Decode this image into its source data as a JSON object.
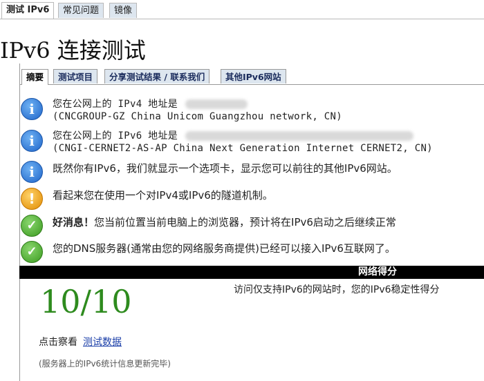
{
  "top_tabs": [
    "测试 IPv6",
    "常见问题",
    "镜像"
  ],
  "page_title": "IPv6 连接测试",
  "inner_tabs": [
    "摘要",
    "测试项目",
    "分享测试结果 / 联系我们",
    "其他IPv6网站"
  ],
  "messages": [
    {
      "type": "info",
      "line1": "您在公网上的 IPv4 地址是",
      "line2": "(CNCGROUP-GZ China Unicom Guangzhou network, CN)"
    },
    {
      "type": "info",
      "line1": "您在公网上的 IPv6 地址是",
      "line2": "(CNGI-CERNET2-AS-AP China Next Generation Internet CERNET2, CN)"
    },
    {
      "type": "info",
      "line1": "既然你有IPv6，我们就显示一个选项卡，显示您可以前往的其他IPv6网站。"
    },
    {
      "type": "warn",
      "line1": "看起来您在使用一个对IPv4或IPv6的隧道机制。"
    },
    {
      "type": "ok",
      "bold": "好消息！",
      "line1": "您当前位置当前电脑上的浏览器，预计将在IPv6启动之后继续正常"
    },
    {
      "type": "ok",
      "line1": "您的DNS服务器(通常由您的网络服务商提供)已经可以接入IPv6互联网了。"
    }
  ],
  "score": {
    "bar_label": "网络得分",
    "note": "访问仅支持IPv6的网站时，您的IPv6稳定性得分",
    "value": "10/10"
  },
  "detail": {
    "label": "点击察看",
    "link": "测试数据"
  },
  "footer_note": "(服务器上的IPv6统计信息更新完毕)",
  "colors": {
    "score": "#2e8b1e",
    "tab_bg": "#dde6ef",
    "link": "#1a3ea8"
  }
}
